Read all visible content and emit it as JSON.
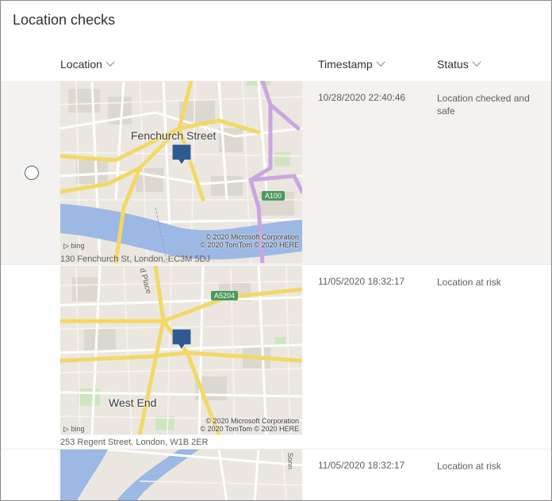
{
  "page": {
    "title": "Location checks"
  },
  "columns": {
    "location": "Location",
    "timestamp": "Timestamp",
    "status": "Status"
  },
  "rows": [
    {
      "address": "130 Fenchurch St, London, EC3M 5DJ",
      "timestamp": "10/28/2020 22:40:46",
      "status": "Location checked and safe",
      "map_label": "Fenchurch Street",
      "road_label_1": "A100",
      "copyright_1": "© 2020 Microsoft Corporation",
      "copyright_2": "© 2020 TomTom © 2020 HERE",
      "bing": "bing",
      "selected": true
    },
    {
      "address": "253 Regent Street, London, W1B 2ER",
      "timestamp": "11/05/2020 18:32:17",
      "status": "Location at risk",
      "map_label": "West End",
      "road_label_1": "A5204",
      "road_label_2": "d Place",
      "copyright_1": "© 2020 Microsoft Corporation",
      "copyright_2": "© 2020 TomTom © 2020 HERE",
      "bing": "bing",
      "selected": false
    },
    {
      "address": "",
      "timestamp": "11/05/2020 18:32:17",
      "status": "Location at risk",
      "road_label_2": "Sonn",
      "selected": false
    }
  ],
  "colors": {
    "selected_row": "#f3f2f1",
    "pin": "#2f5a8f",
    "water": "#9cb8e4",
    "road_major": "#f5dd7a",
    "road_purple": "#c9a6e0",
    "underground": "#d23a3a"
  },
  "icons": {
    "sort": "chevron-down-icon",
    "marker": "map-pin-icon",
    "underground": "underground-roundel-icon",
    "selection": "radio-button-icon"
  }
}
